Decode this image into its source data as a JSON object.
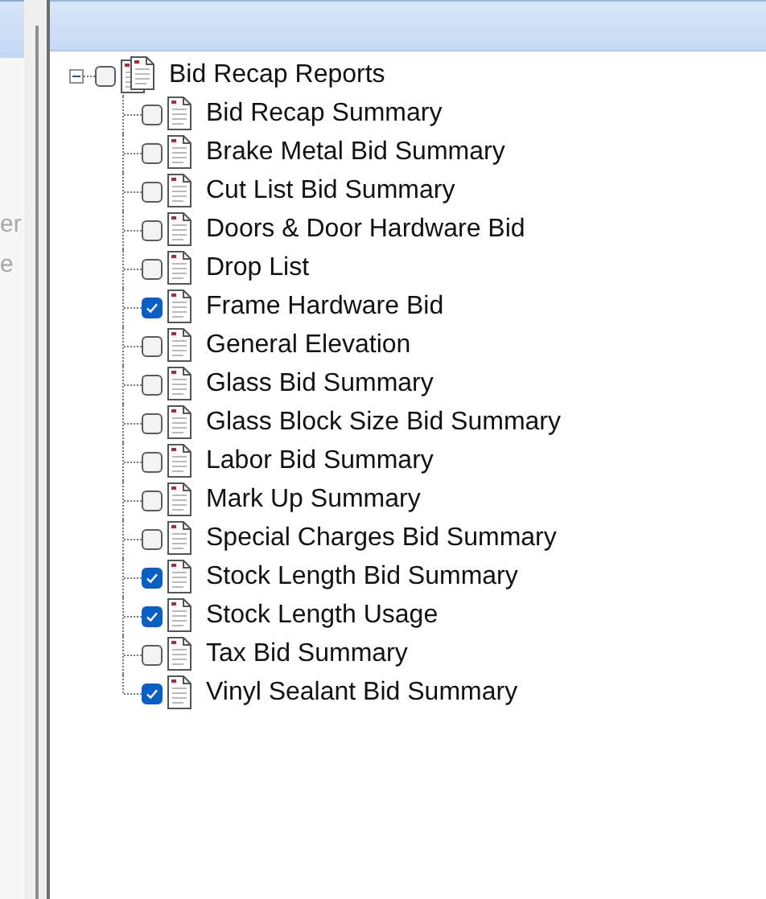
{
  "left_panel": {
    "texts": [
      "er",
      "e"
    ]
  },
  "tree": {
    "label": "Bid Recap Reports",
    "expanded": true,
    "checked": false,
    "children": [
      {
        "label": "Bid Recap Summary",
        "checked": false
      },
      {
        "label": "Brake Metal Bid Summary",
        "checked": false
      },
      {
        "label": "Cut List Bid Summary",
        "checked": false
      },
      {
        "label": "Doors & Door Hardware Bid",
        "checked": false
      },
      {
        "label": "Drop List",
        "checked": false
      },
      {
        "label": "Frame Hardware Bid",
        "checked": true
      },
      {
        "label": "General Elevation",
        "checked": false
      },
      {
        "label": "Glass Bid Summary",
        "checked": false
      },
      {
        "label": "Glass Block Size Bid Summary",
        "checked": false
      },
      {
        "label": "Labor Bid Summary",
        "checked": false
      },
      {
        "label": "Mark Up Summary",
        "checked": false
      },
      {
        "label": "Special Charges Bid Summary",
        "checked": false
      },
      {
        "label": "Stock Length Bid Summary",
        "checked": true
      },
      {
        "label": "Stock Length Usage",
        "checked": true
      },
      {
        "label": "Tax Bid Summary",
        "checked": false
      },
      {
        "label": "Vinyl Sealant Bid Summary",
        "checked": true
      }
    ]
  }
}
